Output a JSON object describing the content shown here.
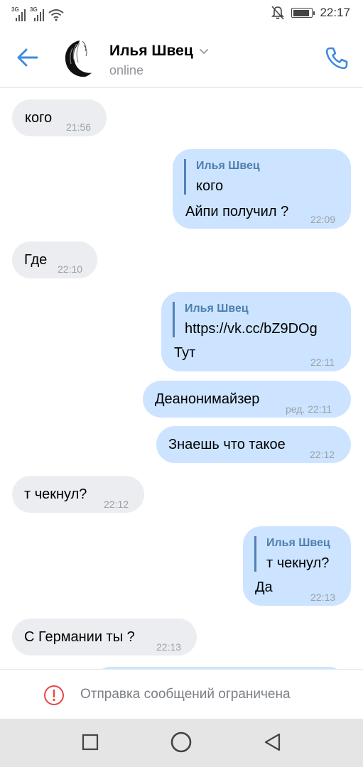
{
  "status_bar": {
    "signal1_label": "3G",
    "signal2_label": "3G",
    "time": "22:17",
    "battery_level": 0.9,
    "icons": [
      "signal-icon",
      "wifi-icon",
      "bell-muted-icon",
      "battery-icon"
    ]
  },
  "header": {
    "contact_name": "Илья Швец",
    "contact_status": "online",
    "icons": [
      "back-arrow-icon",
      "chevron-down-icon",
      "phone-icon"
    ]
  },
  "messages": [
    {
      "direction": "in",
      "text": "кого",
      "time": "21:56"
    },
    {
      "direction": "out",
      "reply_name": "Илья Швец",
      "reply_text": "кого",
      "text": "Айпи получил ?",
      "time": "22:09"
    },
    {
      "direction": "in",
      "text": "Где",
      "time": "22:10"
    },
    {
      "direction": "out",
      "reply_name": "Илья Швец",
      "reply_text": "https://vk.cc/bZ9DOg",
      "text": "Тут",
      "time": "22:11"
    },
    {
      "direction": "out",
      "text": "Деанонимайзер",
      "time": "ред. 22:11"
    },
    {
      "direction": "out",
      "text": "Знаешь что такое",
      "time": "22:12"
    },
    {
      "direction": "in",
      "text": "т чекнул?",
      "time": "22:12"
    },
    {
      "direction": "out",
      "reply_name": "Илья Швец",
      "reply_text": "т чекнул?",
      "text": "Да",
      "time": "22:13"
    },
    {
      "direction": "in",
      "text": "С Германии ты ?",
      "time": "22:13"
    }
  ],
  "restriction": {
    "text": "Отправка сообщений ограничена",
    "icon": "warning-icon"
  },
  "colors": {
    "accent": "#3f8ae0",
    "incoming_bubble": "#ebedf0",
    "outgoing_bubble": "#cce4ff",
    "warning": "#e64646"
  },
  "nav_bar": {
    "icons": [
      "square-icon",
      "circle-icon",
      "triangle-back-icon"
    ]
  }
}
